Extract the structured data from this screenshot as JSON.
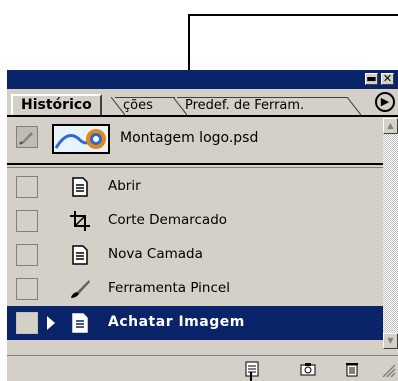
{
  "panel": {
    "tabs": [
      {
        "label": "Histórico",
        "active": true
      },
      {
        "label": "ções",
        "active": false
      },
      {
        "label": "Predef. de Ferram.",
        "active": false
      }
    ],
    "snapshot": {
      "label": "Montagem logo.psd"
    },
    "history": [
      {
        "label": "Abrir",
        "icon": "document-step-icon",
        "selected": false
      },
      {
        "label": "Corte Demarcado",
        "icon": "crop-icon",
        "selected": false
      },
      {
        "label": "Nova Camada",
        "icon": "document-step-icon",
        "selected": false
      },
      {
        "label": "Ferramenta Pincel",
        "icon": "brush-icon",
        "selected": false
      },
      {
        "label": "Achatar Imagem",
        "icon": "document-step-icon",
        "selected": true
      }
    ],
    "colors": {
      "titlebar": "#0a246a",
      "selection": "#0a246a",
      "panel_bg": "#d4d0c8"
    },
    "bottom_icons": [
      "new-document-from-state-icon",
      "new-snapshot-icon",
      "trash-icon"
    ]
  }
}
